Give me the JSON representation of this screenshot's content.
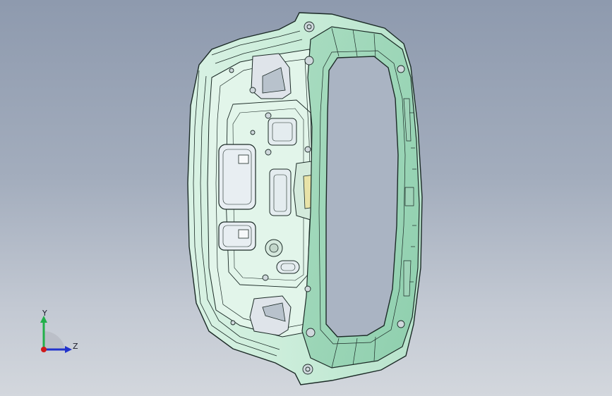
{
  "triad": {
    "y_label": "Y",
    "z_label": "Z",
    "colors": {
      "y": "#22b04a",
      "z": "#2233cc",
      "origin": "#d01a1a"
    }
  },
  "part": {
    "surface_color": "#c8ecd8",
    "edge_color": "#1b2a26",
    "highlight_color": "#e6f7ee"
  }
}
